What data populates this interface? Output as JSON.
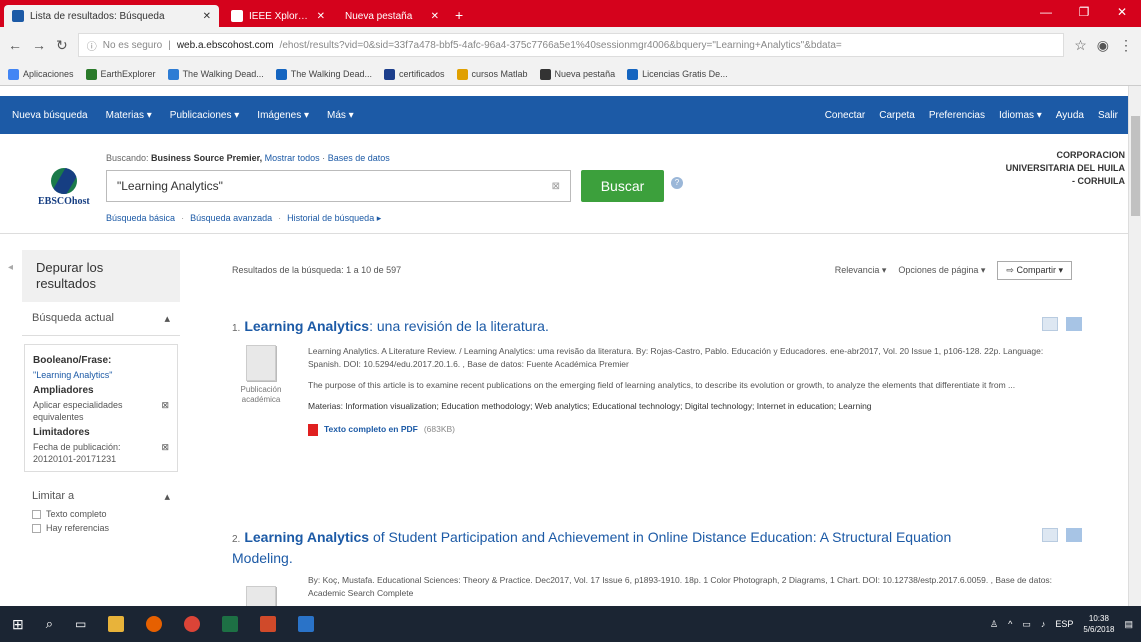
{
  "browser": {
    "tabs": [
      {
        "title": "Lista de resultados: Búsqueda",
        "color": "#1c5aa6",
        "active": true
      },
      {
        "title": "IEEE Xplore Search Results",
        "color": "#1c5aa6",
        "active": false
      },
      {
        "title": "Nueva pestaña",
        "color": "#d5021c",
        "active": false
      }
    ],
    "new_tab": "+",
    "url_security": "No es seguro",
    "url_host": "web.a.ebscohost.com",
    "url_rest": "/ehost/results?vid=0&sid=33f7a478-bbf5-4afc-96a4-375c7766a5e1%40sessionmgr4006&bquery=\"Learning+Analytics\"&bdata=",
    "bookmarks": [
      {
        "label": "Aplicaciones",
        "color": "#4285f4"
      },
      {
        "label": "EarthExplorer",
        "color": "#2a7a2a"
      },
      {
        "label": "The Walking Dead...",
        "color": "#2d7cd4"
      },
      {
        "label": "The Walking Dead...",
        "color": "#1565c0"
      },
      {
        "label": "certificados",
        "color": "#1c3e8c"
      },
      {
        "label": "cursos Matlab",
        "color": "#e0a000"
      },
      {
        "label": "Nueva pestaña",
        "color": "#333"
      },
      {
        "label": "Licencias Gratis De...",
        "color": "#1565c0"
      }
    ]
  },
  "ebsco_nav": {
    "left": [
      "Nueva búsqueda",
      "Materias ▾",
      "Publicaciones ▾",
      "Imágenes ▾",
      "Más ▾"
    ],
    "right": [
      "Conectar",
      "Carpeta",
      "Preferencias",
      "Idiomas ▾",
      "Ayuda",
      "Salir"
    ]
  },
  "search": {
    "logo_text": "EBSCOhost",
    "searching_label": "Buscando:",
    "database": "Business Source Premier,",
    "show_all": "Mostrar todos",
    "choose_db": "Bases de datos",
    "query": "\"Learning Analytics\"",
    "button": "Buscar",
    "help": "?",
    "links": [
      "Búsqueda básica",
      "Búsqueda avanzada",
      "Historial de búsqueda ▸"
    ],
    "institution": [
      "CORPORACION",
      "UNIVERSITARIA DEL HUILA",
      "- CORHUILA"
    ]
  },
  "sidebar": {
    "refine": "Depurar los resultados",
    "current_search": "Búsqueda actual",
    "boolean_label": "Booleano/Frase:",
    "boolean_value": "\"Learning Analytics\"",
    "expanders_label": "Ampliadores",
    "expander_value": "Aplicar especialidades equivalentes",
    "limiters_label": "Limitadores",
    "limiter_value": "Fecha de publicación: 20120101-20171231",
    "limit_to": "Limitar a",
    "checkboxes": [
      "Texto completo",
      "Hay referencias"
    ]
  },
  "results": {
    "summary": "Resultados de la búsqueda: 1 a 10 de 597",
    "sort": "Relevancia ▾",
    "page_options": "Opciones de página ▾",
    "share": "Compartir ▾",
    "items": [
      {
        "num": "1.",
        "title_bold": "Learning Analytics",
        "title_rest": ": una revisión de la literatura.",
        "type": "Publicación académica",
        "citation": "Learning Analytics. A Literature Review. / Learning Analytics: uma revisão da literatura. By: Rojas-Castro, Pablo. Educación y Educadores. ene-abr2017, Vol. 20 Issue 1, p106-128. 22p. Language: Spanish. DOI: 10.5294/edu.2017.20.1.6. , Base de datos: Fuente Académica Premier",
        "abstract": "The purpose of this article is to examine recent publications on the emerging field of learning analytics, to describe its evolution or growth, to analyze the elements that differentiate it from ...",
        "subjects": "Materias: Information visualization; Education methodology; Web analytics; Educational technology; Digital technology; Internet in education; Learning",
        "pdf": "Texto completo en PDF",
        "pdf_size": "(683KB)"
      },
      {
        "num": "2.",
        "title_bold": "Learning Analytics",
        "title_rest": " of Student Participation and Achievement in Online Distance Education: A Structural Equation Modeling.",
        "type": "",
        "citation": "By: Koç, Mustafa. Educational Sciences: Theory & Practice. Dec2017, Vol. 17 Issue 6, p1893-1910. 18p. 1 Color Photograph, 2 Diagrams, 1 Chart. DOI: 10.12738/estp.2017.6.0059. , Base de datos: Academic Search Complete",
        "abstract": "",
        "subjects": "",
        "pdf": "",
        "pdf_size": ""
      }
    ]
  },
  "taskbar": {
    "lang": "ESP",
    "time": "10:38",
    "date": "5/6/2018"
  }
}
